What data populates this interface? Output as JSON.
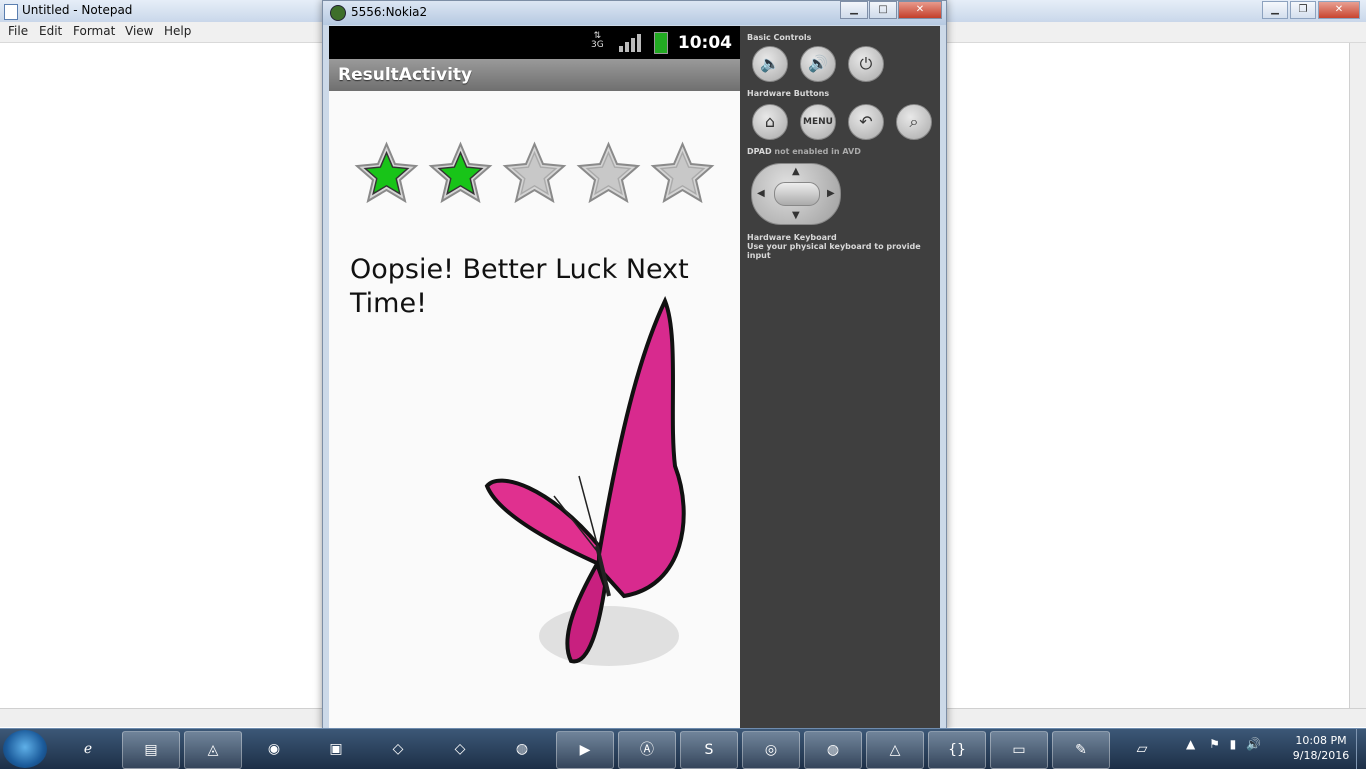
{
  "notepad": {
    "title": "Untitled - Notepad",
    "menu": [
      "File",
      "Edit",
      "Format",
      "View",
      "Help"
    ]
  },
  "emulator": {
    "title": "5556:Nokia2",
    "status": {
      "network": "3G",
      "time": "10:04"
    },
    "activity_title": "ResultActivity",
    "rating": {
      "value": 2,
      "max": 5
    },
    "message": "Oopsie! Better Luck Next Time!",
    "controls": {
      "basic_label": "Basic Controls",
      "hardware_label": "Hardware Buttons",
      "menu_label": "MENU",
      "dpad_label": "DPAD",
      "dpad_note": "not enabled in AVD",
      "keyboard_label": "Hardware Keyboard",
      "keyboard_note": "Use your physical keyboard to provide input"
    }
  },
  "colors": {
    "star_on": "#18c418",
    "star_off": "#c8c8c8",
    "butterfly": "#e0308f"
  },
  "taskbar": {
    "apps": [
      "internet-explorer",
      "file-explorer",
      "android-studio",
      "firefox",
      "media-player",
      "unity",
      "unity",
      "chrome",
      "presentation",
      "acrobat-reader",
      "sublime-text",
      "network-tool",
      "chrome",
      "vlc",
      "brackets",
      "android-device",
      "paint",
      "notepad"
    ],
    "clock": {
      "time": "10:08 PM",
      "date": "9/18/2016"
    }
  }
}
